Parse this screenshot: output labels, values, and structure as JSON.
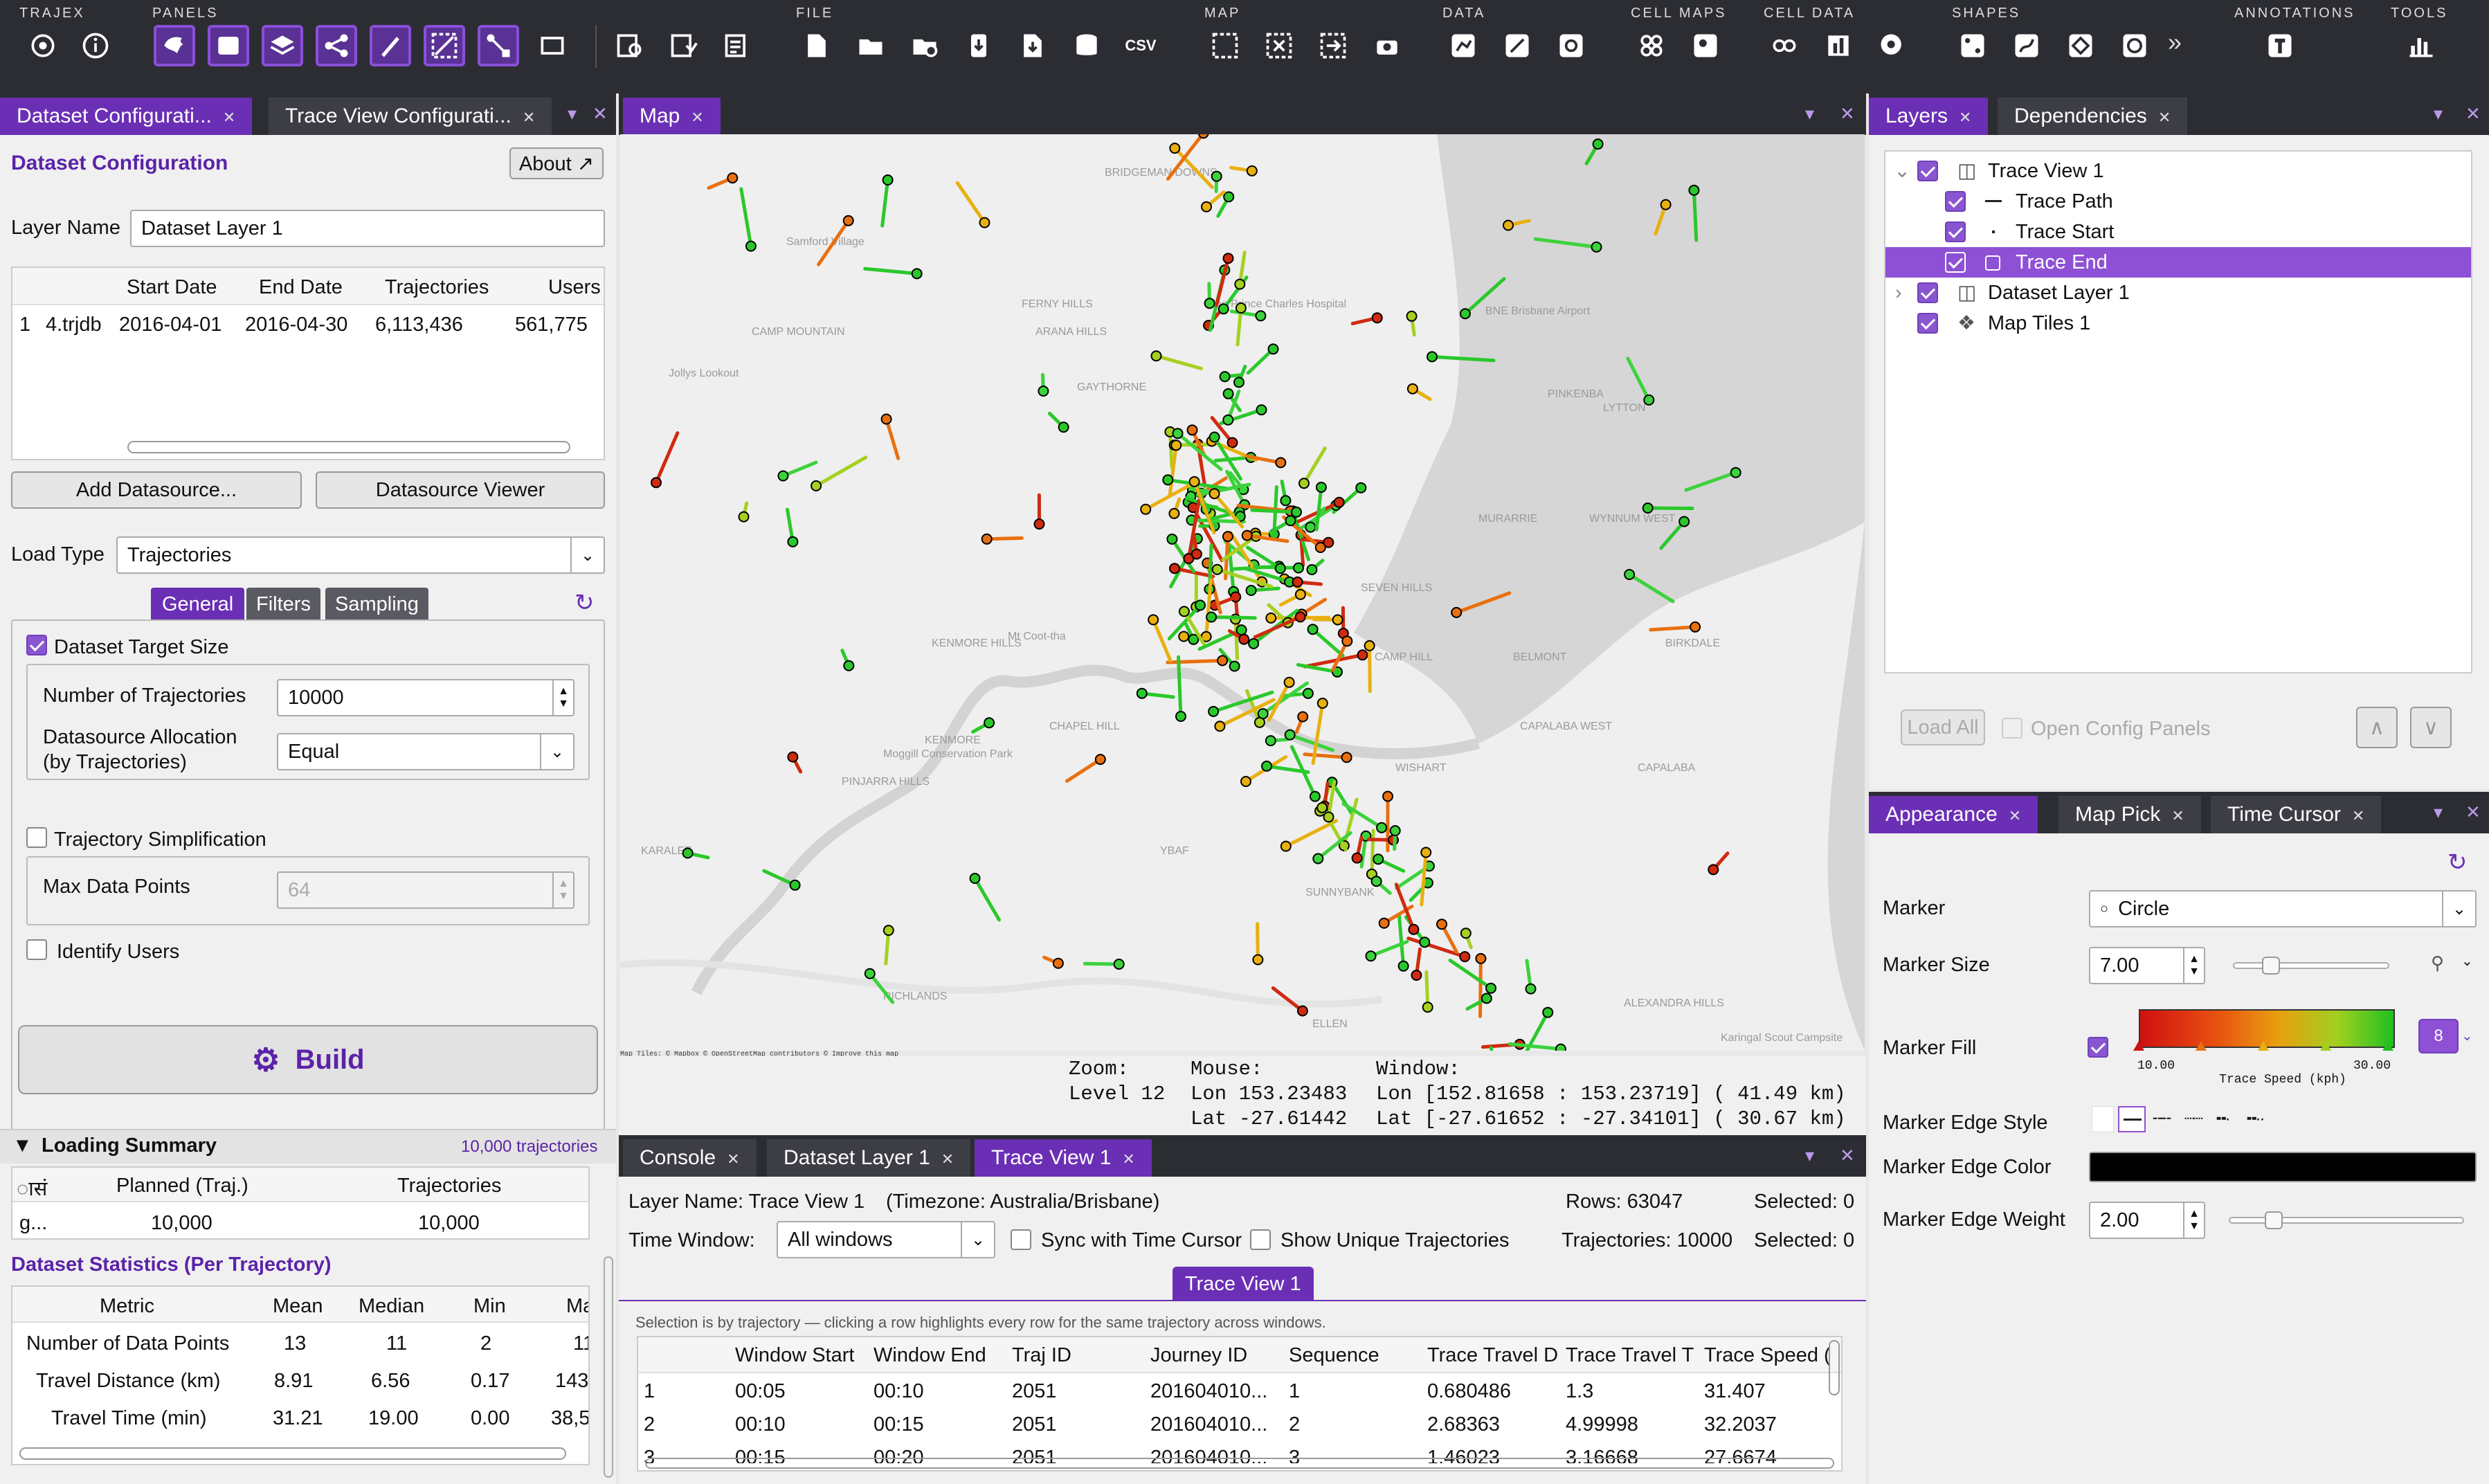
{
  "toolbar": {
    "groups": [
      {
        "label": "TRAJEX"
      },
      {
        "label": "PANELS"
      },
      {
        "label": "FILE"
      },
      {
        "label": "MAP"
      },
      {
        "label": "DATA"
      },
      {
        "label": "CELL MAPS"
      },
      {
        "label": "CELL DATA"
      },
      {
        "label": "SHAPES"
      },
      {
        "label": "ANNOTATIONS"
      },
      {
        "label": "TOOLS"
      }
    ],
    "csv_label": "CSV",
    "overflow": "»"
  },
  "left_tabs": [
    {
      "label": "Dataset Configurati..."
    },
    {
      "label": "Trace View Configurati..."
    }
  ],
  "dataset_config": {
    "title": "Dataset Configuration",
    "about_label": "About ↗",
    "layer_name_label": "Layer Name",
    "layer_name_value": "Dataset Layer 1",
    "source_table": {
      "headers": [
        "",
        "Start Date",
        "End Date",
        "Trajectories",
        "Users"
      ],
      "rows": [
        {
          "index": "1",
          "file": "4.trjdb",
          "start": "2016-04-01",
          "end": "2016-04-30",
          "trajectories": "6,113,436",
          "users": "561,775"
        }
      ]
    },
    "add_datasource_label": "Add Datasource...",
    "datasource_viewer_label": "Datasource Viewer",
    "load_type_label": "Load Type",
    "load_type_value": "Trajectories",
    "subtabs": [
      "General",
      "Filters",
      "Sampling"
    ],
    "dataset_target_size_label": "Dataset Target Size",
    "num_traj_label": "Number of Trajectories",
    "num_traj_value": "10000",
    "alloc_label_1": "Datasource Allocation",
    "alloc_label_2": "(by Trajectories)",
    "alloc_value": "Equal",
    "simplification_label": "Trajectory Simplification",
    "max_points_label": "Max Data Points",
    "max_points_value": "64",
    "identify_users_label": "Identify Users",
    "build_label": "Build"
  },
  "loading_summary": {
    "title": "Loading Summary",
    "count": "10,000 trajectories",
    "headers": [
      "ासं",
      "Planned (Traj.)",
      "Trajectories"
    ],
    "row": [
      "g...",
      "10,000",
      "10,000"
    ]
  },
  "dataset_stats": {
    "title": "Dataset Statistics (Per Trajectory)",
    "headers": [
      "Metric",
      "Mean",
      "Median",
      "Min",
      "Ma"
    ],
    "rows": [
      {
        "metric": "Number of Data Points",
        "mean": "13",
        "median": "11",
        "min": "2",
        "max": "11"
      },
      {
        "metric": "Travel Distance (km)",
        "mean": "8.91",
        "median": "6.56",
        "min": "0.17",
        "max": "143"
      },
      {
        "metric": "Travel Time (min)",
        "mean": "31.21",
        "median": "19.00",
        "min": "0.00",
        "max": "38,5"
      }
    ]
  },
  "map_tab": {
    "label": "Map"
  },
  "map": {
    "places": [
      {
        "name": "BRIDGEMAN DOWNS"
      },
      {
        "name": "Samford Village"
      },
      {
        "name": "FERNY HILLS"
      },
      {
        "name": "ARANA HILLS"
      },
      {
        "name": "CAMP MOUNTAIN"
      },
      {
        "name": "Jollys Lookout"
      },
      {
        "name": "GAYTHORNE"
      },
      {
        "name": "The Prince Charles Hospital"
      },
      {
        "name": "BNE Brisbane Airport"
      },
      {
        "name": "PINKENBA"
      },
      {
        "name": "LYTTON"
      },
      {
        "name": "WYNNUM WEST"
      },
      {
        "name": "MURARRIE"
      },
      {
        "name": "KENMORE HILLS"
      },
      {
        "name": "Mt Coot-tha"
      },
      {
        "name": "SEVEN HILLS"
      },
      {
        "name": "CAMP HILL"
      },
      {
        "name": "BELMONT"
      },
      {
        "name": "BIRKDALE"
      },
      {
        "name": "CHAPEL HILL"
      },
      {
        "name": "KENMORE"
      },
      {
        "name": "Moggill Conservation Park"
      },
      {
        "name": "PINJARRA HILLS"
      },
      {
        "name": "WISHART"
      },
      {
        "name": "CAPALABA WEST"
      },
      {
        "name": "CAPALABA"
      },
      {
        "name": "KARALEE"
      },
      {
        "name": "YBAF"
      },
      {
        "name": "SUNNYBANK"
      },
      {
        "name": "RICHLANDS"
      },
      {
        "name": "ELLEN"
      },
      {
        "name": "ALEXANDRA HILLS"
      },
      {
        "name": "Karingal Scout Campsite"
      }
    ],
    "attribution": "Map Tiles: © Mapbox © OpenStreetMap contributors © Improve this map",
    "readout": {
      "zoom_label": "Zoom:",
      "zoom_value": "Level 12",
      "mouse_label": "Mouse:",
      "mouse_lon": "Lon 153.23483",
      "mouse_lat": "Lat -27.61442",
      "window_label": "Window:",
      "window_lon": "Lon [152.81658 : 153.23719] ( 41.49 km)",
      "window_lat": "Lat [-27.61652 : -27.34101] ( 30.67 km)"
    }
  },
  "right_tabs": [
    {
      "label": "Layers"
    },
    {
      "label": "Dependencies"
    }
  ],
  "layers": {
    "items": [
      {
        "label": "Trace View 1",
        "checked": true,
        "level": 0,
        "expanded": true
      },
      {
        "label": "Trace Path",
        "checked": true,
        "level": 1
      },
      {
        "label": "Trace Start",
        "checked": true,
        "level": 1
      },
      {
        "label": "Trace End",
        "checked": true,
        "level": 1,
        "selected": true
      },
      {
        "label": "Dataset Layer 1",
        "checked": true,
        "level": 0,
        "expanded": false
      },
      {
        "label": "Map Tiles 1",
        "checked": true,
        "level": 0
      }
    ],
    "load_all_label": "Load All",
    "open_config_label": "Open Config Panels"
  },
  "appearance_tabs": [
    {
      "label": "Appearance"
    },
    {
      "label": "Map Pick"
    },
    {
      "label": "Time Cursor"
    }
  ],
  "appearance": {
    "marker_label": "Marker",
    "marker_value": "Circle",
    "marker_size_label": "Marker Size",
    "marker_size_value": "7.00",
    "marker_size_fraction": 0.2,
    "marker_fill_label": "Marker Fill",
    "gradient_min": "10.00",
    "gradient_max": "30.00",
    "gradient_caption": "Trace Speed (kph)",
    "gradient_button": "8",
    "edge_style_label": "Marker Edge Style",
    "edge_color_label": "Marker Edge Color",
    "edge_color": "#000000",
    "edge_weight_label": "Marker Edge Weight",
    "edge_weight_value": "2.00",
    "edge_weight_fraction": 0.16
  },
  "bottom_tabs": [
    {
      "label": "Console"
    },
    {
      "label": "Dataset Layer 1"
    },
    {
      "label": "Trace View 1"
    }
  ],
  "trace_table": {
    "layer_name_text": "Layer Name: Trace View 1",
    "timezone_text": "(Timezone: Australia/Brisbane)",
    "rows_text": "Rows: 63047",
    "selected_text_1": "Selected: 0",
    "time_window_label": "Time Window:",
    "time_window_value": "All windows",
    "sync_label": "Sync with Time Cursor",
    "unique_label": "Show Unique Trajectories",
    "trajectories_text": "Trajectories: 10000",
    "selected_text_2": "Selected: 0",
    "subtab": "Trace View 1",
    "note": "Selection is by trajectory — clicking a row highlights every row for the same trajectory across windows.",
    "headers": [
      "",
      "Window Start",
      "Window End",
      "Traj ID",
      "Journey ID",
      "Sequence",
      "Trace Travel D",
      "Trace Travel T",
      "Trace Speed ("
    ],
    "rows": [
      [
        "1",
        "00:05",
        "00:10",
        "2051",
        "201604010...",
        "1",
        "0.680486",
        "1.3",
        "31.407"
      ],
      [
        "2",
        "00:10",
        "00:15",
        "2051",
        "201604010...",
        "2",
        "2.68363",
        "4.99998",
        "32.2037"
      ],
      [
        "3",
        "00:15",
        "00:20",
        "2051",
        "201604010...",
        "3",
        "1.46023",
        "3.16668",
        "27.6674"
      ]
    ]
  },
  "colors": {
    "accent": "#6b2fb5",
    "toolbar_bg": "#2c2d33",
    "heading": "#5b23a8",
    "speed_low": "#d01010",
    "speed_mid": "#e8a010",
    "speed_high": "#20c020"
  }
}
